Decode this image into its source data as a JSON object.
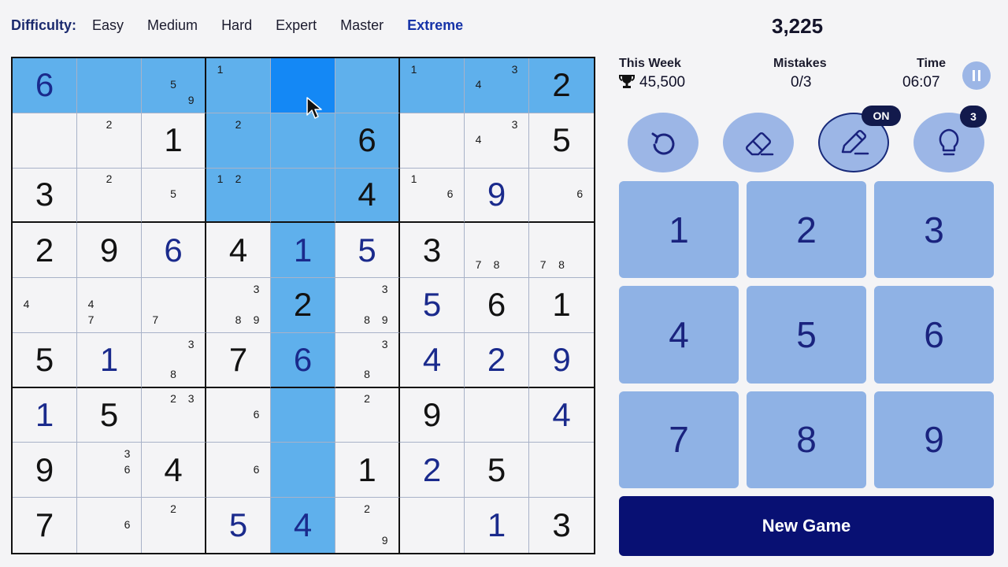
{
  "difficulty": {
    "label": "Difficulty:",
    "options": [
      "Easy",
      "Medium",
      "Hard",
      "Expert",
      "Master",
      "Extreme"
    ],
    "selected": "Extreme"
  },
  "score": "3,225",
  "stats": {
    "week_label": "This Week",
    "week_value": "45,500",
    "mistakes_label": "Mistakes",
    "mistakes_value": "0/3",
    "time_label": "Time",
    "time_value": "06:07"
  },
  "actions": {
    "notes_badge": "ON",
    "hint_badge": "3"
  },
  "numpad": [
    "1",
    "2",
    "3",
    "4",
    "5",
    "6",
    "7",
    "8",
    "9"
  ],
  "new_game_label": "New Game",
  "board": {
    "selected_cell": [
      0,
      4
    ],
    "highlighted_cells": [
      [
        0,
        0
      ],
      [
        0,
        1
      ],
      [
        0,
        2
      ],
      [
        0,
        3
      ],
      [
        0,
        5
      ],
      [
        0,
        6
      ],
      [
        0,
        7
      ],
      [
        0,
        8
      ],
      [
        1,
        3
      ],
      [
        1,
        4
      ],
      [
        1,
        5
      ],
      [
        2,
        3
      ],
      [
        2,
        4
      ],
      [
        2,
        5
      ],
      [
        3,
        4
      ],
      [
        4,
        4
      ],
      [
        5,
        4
      ],
      [
        6,
        4
      ],
      [
        7,
        4
      ],
      [
        8,
        4
      ]
    ],
    "cells": [
      [
        {
          "v": "6",
          "t": "user"
        },
        {
          "n": []
        },
        {
          "n": [
            "5",
            "9"
          ]
        },
        {
          "n": [
            "1"
          ]
        },
        {
          "n": []
        },
        {
          "n": []
        },
        {
          "n": [
            "1"
          ]
        },
        {
          "n": [
            "3",
            "4"
          ]
        },
        {
          "v": "2",
          "t": "given"
        }
      ],
      [
        {
          "n": []
        },
        {
          "n": [
            "2"
          ]
        },
        {
          "v": "1",
          "t": "given"
        },
        {
          "n": [
            "2"
          ]
        },
        {
          "n": []
        },
        {
          "v": "6",
          "t": "given"
        },
        {
          "n": []
        },
        {
          "n": [
            "3",
            "4"
          ]
        },
        {
          "v": "5",
          "t": "given"
        }
      ],
      [
        {
          "v": "3",
          "t": "given"
        },
        {
          "n": [
            "2"
          ]
        },
        {
          "n": [
            "5"
          ]
        },
        {
          "n": [
            "1",
            "2"
          ]
        },
        {
          "n": []
        },
        {
          "v": "4",
          "t": "given"
        },
        {
          "n": [
            "1",
            "6"
          ]
        },
        {
          "v": "9",
          "t": "user"
        },
        {
          "n": [
            "6"
          ]
        }
      ],
      [
        {
          "v": "2",
          "t": "given"
        },
        {
          "v": "9",
          "t": "given"
        },
        {
          "v": "6",
          "t": "user"
        },
        {
          "v": "4",
          "t": "given"
        },
        {
          "v": "1",
          "t": "user"
        },
        {
          "v": "5",
          "t": "user"
        },
        {
          "v": "3",
          "t": "given"
        },
        {
          "n": [
            "7",
            "8"
          ]
        },
        {
          "n": [
            "7",
            "8"
          ]
        }
      ],
      [
        {
          "n": [
            "4"
          ]
        },
        {
          "n": [
            "4",
            "7"
          ]
        },
        {
          "n": [
            "7"
          ]
        },
        {
          "n": [
            "3",
            "8",
            "9"
          ]
        },
        {
          "v": "2",
          "t": "given"
        },
        {
          "n": [
            "3",
            "8",
            "9"
          ]
        },
        {
          "v": "5",
          "t": "user"
        },
        {
          "v": "6",
          "t": "given"
        },
        {
          "v": "1",
          "t": "given"
        }
      ],
      [
        {
          "v": "5",
          "t": "given"
        },
        {
          "v": "1",
          "t": "user"
        },
        {
          "n": [
            "3",
            "8"
          ]
        },
        {
          "v": "7",
          "t": "given"
        },
        {
          "v": "6",
          "t": "user"
        },
        {
          "n": [
            "3",
            "8"
          ]
        },
        {
          "v": "4",
          "t": "user"
        },
        {
          "v": "2",
          "t": "user"
        },
        {
          "v": "9",
          "t": "user"
        }
      ],
      [
        {
          "v": "1",
          "t": "user"
        },
        {
          "v": "5",
          "t": "given"
        },
        {
          "n": [
            "2",
            "3"
          ]
        },
        {
          "n": [
            "6"
          ]
        },
        {
          "n": []
        },
        {
          "n": [
            "2"
          ]
        },
        {
          "v": "9",
          "t": "given"
        },
        {
          "n": []
        },
        {
          "v": "4",
          "t": "user"
        }
      ],
      [
        {
          "v": "9",
          "t": "given"
        },
        {
          "n": [
            "3",
            "6"
          ]
        },
        {
          "v": "4",
          "t": "given"
        },
        {
          "n": [
            "6"
          ]
        },
        {
          "n": []
        },
        {
          "v": "1",
          "t": "given"
        },
        {
          "v": "2",
          "t": "user"
        },
        {
          "v": "5",
          "t": "given"
        },
        {
          "n": []
        }
      ],
      [
        {
          "v": "7",
          "t": "given"
        },
        {
          "n": [
            "6"
          ]
        },
        {
          "n": [
            "2"
          ]
        },
        {
          "v": "5",
          "t": "user"
        },
        {
          "v": "4",
          "t": "user"
        },
        {
          "n": [
            "2",
            "9"
          ]
        },
        {
          "n": []
        },
        {
          "v": "1",
          "t": "user"
        },
        {
          "v": "3",
          "t": "given"
        }
      ]
    ]
  }
}
